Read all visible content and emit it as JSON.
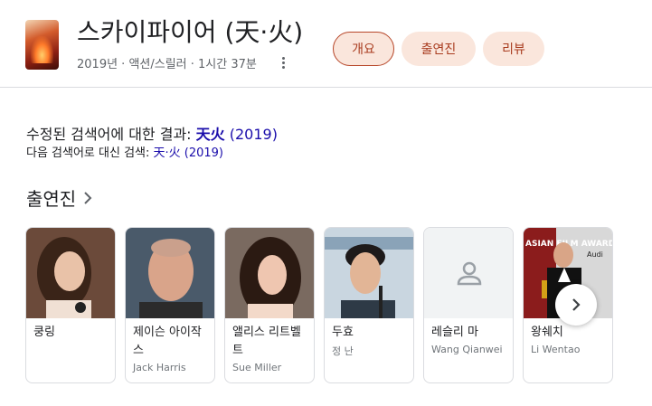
{
  "header": {
    "title": "스카이파이어 (天·火)",
    "subtitle": "2019년 · 액션/스릴러 · 1시간 37분",
    "tabs": [
      {
        "label": "개요",
        "active": true
      },
      {
        "label": "출연진",
        "active": false
      },
      {
        "label": "리뷰",
        "active": false
      }
    ]
  },
  "search_note": {
    "prefix": "수정된 검색어에 대한 결과: ",
    "query": "天火",
    "year": " (2019)",
    "alt_prefix": "다음 검색어로 대신 검색: ",
    "alt_query": "天·火 (2019)"
  },
  "cast_section": {
    "title": "출연진",
    "cast": [
      {
        "name": "쿵링",
        "role": ""
      },
      {
        "name": "제이슨 아이작스",
        "role": "Jack Harris"
      },
      {
        "name": "앨리스 리트벨트",
        "role": "Sue Miller"
      },
      {
        "name": "두효",
        "role": "정 난"
      },
      {
        "name": "레슬리 마",
        "role": "Wang Qianwei"
      },
      {
        "name": "왕쉐치",
        "role": "Li Wentao"
      }
    ],
    "poster_text": "ASIAN FILM AWARDS",
    "poster_logo": "Audi"
  },
  "colors": {
    "accent": "#a93c1f",
    "tab_bg": "#fae6dc",
    "link": "#1a0dab"
  }
}
